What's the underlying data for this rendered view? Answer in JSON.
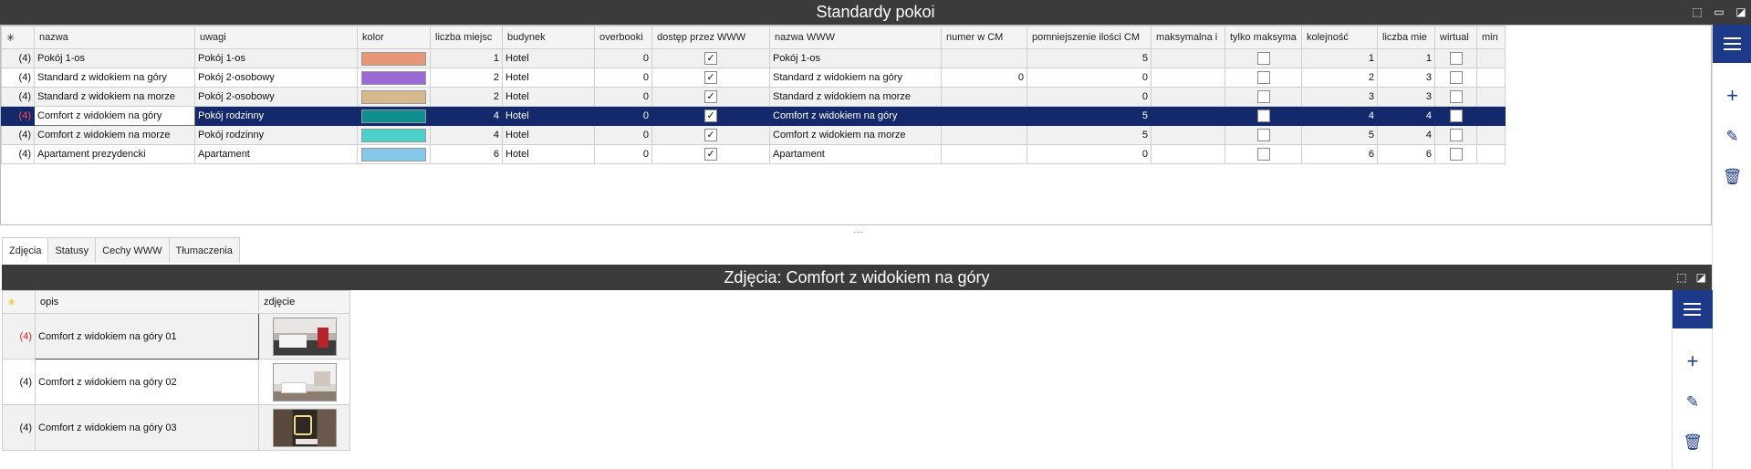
{
  "window": {
    "title": "Standardy pokoi"
  },
  "grid": {
    "new_row_marker": "✳",
    "columns": [
      "nazwa",
      "uwagi",
      "kolor",
      "liczba miejsc",
      "budynek",
      "overbooki",
      "dostęp przez WWW",
      "nazwa WWW",
      "numer w CM",
      "pomniejszenie ilości CM",
      "maksymalna i",
      "tylko maksyma",
      "kolejność",
      "liczba mie",
      "wirtual",
      "min"
    ],
    "rows": [
      {
        "marker": "(4)",
        "nazwa": "Pokój 1-os",
        "uwagi": "Pokój 1-os",
        "kolor": "#e8967a",
        "liczba": "1",
        "budynek": "Hotel",
        "overbooki": "0",
        "www": "✓",
        "nazwa_www": "Pokój 1-os",
        "numer_cm": "",
        "pomniejszenie": "5",
        "maksymalna": "",
        "tylko": "",
        "kolejnosc": "1",
        "liczba_mie": "1",
        "wirtual": "",
        "min": ""
      },
      {
        "marker": "(4)",
        "nazwa": "Standard z widokiem na góry",
        "uwagi": "Pokój 2-osobowy",
        "kolor": "#9b6ad6",
        "liczba": "2",
        "budynek": "Hotel",
        "overbooki": "0",
        "www": "✓",
        "nazwa_www": "Standard z widokiem na góry",
        "numer_cm": "0",
        "pomniejszenie": "0",
        "maksymalna": "",
        "tylko": "",
        "kolejnosc": "2",
        "liczba_mie": "3",
        "wirtual": "",
        "min": ""
      },
      {
        "marker": "(4)",
        "nazwa": "Standard z widokiem na morze",
        "uwagi": "Pokój 2-osobowy",
        "kolor": "#d7b88f",
        "liczba": "2",
        "budynek": "Hotel",
        "overbooki": "0",
        "www": "✓",
        "nazwa_www": "Standard z widokiem na morze",
        "numer_cm": "",
        "pomniejszenie": "0",
        "maksymalna": "",
        "tylko": "",
        "kolejnosc": "3",
        "liczba_mie": "3",
        "wirtual": "",
        "min": ""
      },
      {
        "marker": "(4)",
        "nazwa": "Comfort z widokiem na góry",
        "uwagi": "Pokój rodzinny",
        "kolor": "#0f8f8f",
        "liczba": "4",
        "budynek": "Hotel",
        "overbooki": "0",
        "www": "✓",
        "nazwa_www": "Comfort z widokiem na góry",
        "numer_cm": "",
        "pomniejszenie": "5",
        "maksymalna": "",
        "tylko": "",
        "kolejnosc": "4",
        "liczba_mie": "4",
        "wirtual": "",
        "min": ""
      },
      {
        "marker": "(4)",
        "nazwa": "Comfort z widokiem na morze",
        "uwagi": "Pokój rodzinny",
        "kolor": "#4bd1c9",
        "liczba": "4",
        "budynek": "Hotel",
        "overbooki": "0",
        "www": "✓",
        "nazwa_www": "Comfort z widokiem na morze",
        "numer_cm": "",
        "pomniejszenie": "5",
        "maksymalna": "",
        "tylko": "",
        "kolejnosc": "5",
        "liczba_mie": "4",
        "wirtual": "",
        "min": ""
      },
      {
        "marker": "(4)",
        "nazwa": "Apartament prezydencki",
        "uwagi": "Apartament",
        "kolor": "#86c8ea",
        "liczba": "6",
        "budynek": "Hotel",
        "overbooki": "0",
        "www": "✓",
        "nazwa_www": "Apartament",
        "numer_cm": "",
        "pomniejszenie": "0",
        "maksymalna": "",
        "tylko": "",
        "kolejnosc": "6",
        "liczba_mie": "6",
        "wirtual": "",
        "min": ""
      }
    ]
  },
  "splitter": "...",
  "tabs": [
    "Zdjęcia",
    "Statusy",
    "Cechy WWW",
    "Tłumaczenia"
  ],
  "sub_panel": {
    "title": "Zdjęcia: Comfort z widokiem na góry",
    "new_row_marker": "✳",
    "columns": [
      "opis",
      "zdjęcie"
    ],
    "rows": [
      {
        "marker": "(4)",
        "opis": "Comfort z widokiem na góry 01"
      },
      {
        "marker": "(4)",
        "opis": "Comfort z widokiem na góry 02"
      },
      {
        "marker": "(4)",
        "opis": "Comfort z widokiem na góry 03"
      }
    ]
  },
  "icons": {
    "menu": "hamburger-icon",
    "add": "plus-icon",
    "edit": "edit-icon",
    "delete": "trash-icon"
  },
  "colors": {
    "accent": "#1d3a8a",
    "selection": "#14296b",
    "titlebar": "#3b3b3b"
  }
}
